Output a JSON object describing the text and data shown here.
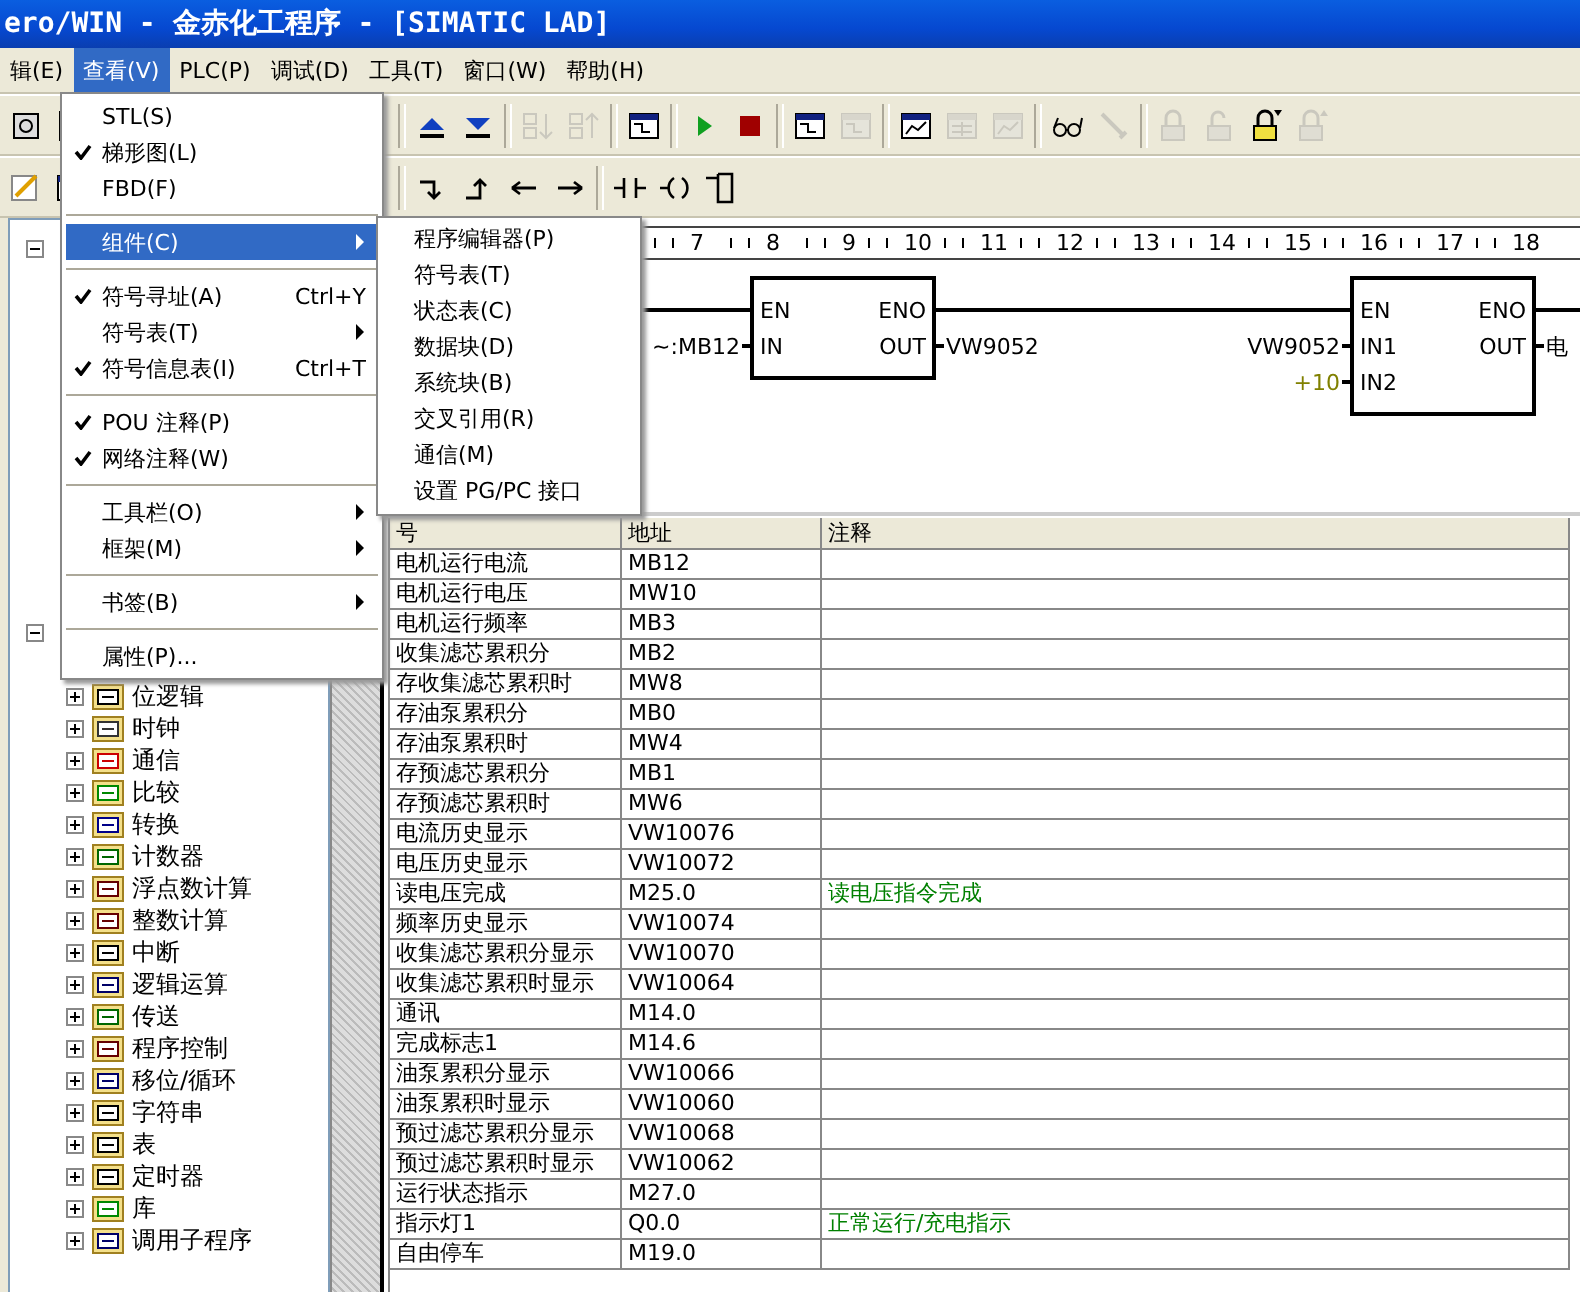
{
  "window": {
    "title": "ero/WIN - 金赤化工程序 - [SIMATIC LAD]"
  },
  "menu_bar": [
    {
      "label": "辑(E)",
      "selected": false
    },
    {
      "label": "查看(V)",
      "selected": true
    },
    {
      "label": "PLC(P)",
      "selected": false
    },
    {
      "label": "调试(D)",
      "selected": false
    },
    {
      "label": "工具(T)",
      "selected": false
    },
    {
      "label": "窗口(W)",
      "selected": false
    },
    {
      "label": "帮助(H)",
      "selected": false
    }
  ],
  "toolbars": [
    {
      "left": [
        {
          "kind": "print",
          "disabled": false
        },
        {
          "kind": "preview",
          "disabled": false
        }
      ],
      "right": [
        [
          {
            "kind": "up",
            "disabled": false
          },
          {
            "kind": "down",
            "disabled": false
          }
        ],
        [
          {
            "kind": "sort-asc",
            "disabled": true
          },
          {
            "kind": "sort-desc",
            "disabled": true
          }
        ],
        [
          {
            "kind": "window",
            "disabled": false
          }
        ],
        [
          {
            "kind": "play",
            "disabled": false
          },
          {
            "kind": "stop",
            "disabled": false
          }
        ],
        [
          {
            "kind": "network",
            "disabled": false
          },
          {
            "kind": "network",
            "disabled": true
          }
        ],
        [
          {
            "kind": "chart",
            "disabled": false
          },
          {
            "kind": "grid",
            "disabled": true
          },
          {
            "kind": "chart",
            "disabled": true
          }
        ],
        [
          {
            "kind": "glasses",
            "disabled": false
          },
          {
            "kind": "pen",
            "disabled": true
          }
        ],
        [
          {
            "kind": "lock",
            "disabled": true
          },
          {
            "kind": "unlock",
            "disabled": true
          },
          {
            "kind": "lock-t",
            "disabled": false
          },
          {
            "kind": "lock-up",
            "disabled": true
          }
        ]
      ]
    },
    {
      "left": [
        {
          "kind": "edit",
          "disabled": false
        },
        {
          "kind": "grid",
          "disabled": false
        }
      ],
      "right": [
        [
          {
            "kind": "branch-down",
            "disabled": false
          },
          {
            "kind": "branch-up",
            "disabled": false
          },
          {
            "kind": "left",
            "disabled": false
          },
          {
            "kind": "right",
            "disabled": false
          }
        ],
        [
          {
            "kind": "contact",
            "disabled": false
          },
          {
            "kind": "coil",
            "disabled": false
          },
          {
            "kind": "box",
            "disabled": false
          }
        ]
      ]
    }
  ],
  "view_menu": {
    "groups": [
      [
        {
          "label": "STL(S)",
          "checked": false
        },
        {
          "label": "梯形图(L)",
          "checked": true
        },
        {
          "label": "FBD(F)",
          "checked": false
        }
      ],
      [
        {
          "label": "组件(C)",
          "checked": false,
          "submenu": true,
          "selected": true
        }
      ],
      [
        {
          "label": "符号寻址(A)",
          "shortcut": "Ctrl+Y",
          "checked": true
        },
        {
          "label": "符号表(T)",
          "checked": false,
          "submenu": true
        },
        {
          "label": "符号信息表(I)",
          "shortcut": "Ctrl+T",
          "checked": true
        }
      ],
      [
        {
          "label": "POU 注释(P)",
          "checked": true
        },
        {
          "label": "网络注释(W)",
          "checked": true
        }
      ],
      [
        {
          "label": "工具栏(O)",
          "checked": false,
          "submenu": true
        },
        {
          "label": "框架(M)",
          "checked": false,
          "submenu": true
        }
      ],
      [
        {
          "label": "书签(B)",
          "checked": false,
          "submenu": true
        }
      ],
      [
        {
          "label": "属性(P)...",
          "checked": false
        }
      ]
    ]
  },
  "submenu": [
    "程序编辑器(P)",
    "符号表(T)",
    "状态表(C)",
    "数据块(D)",
    "系统块(B)",
    "交叉引用(R)",
    "通信(M)",
    "设置 PG/PC 接口"
  ],
  "tree": [
    {
      "expanded": true
    },
    {
      "expanded": true,
      "children": [
        {
          "label": "位逻辑",
          "kind": "contact"
        },
        {
          "label": "时钟",
          "kind": "clock"
        },
        {
          "label": "通信",
          "kind": "bolt"
        },
        {
          "label": "比较",
          "kind": "compare"
        },
        {
          "label": "转换",
          "kind": "convert"
        },
        {
          "label": "计数器",
          "kind": "counter"
        },
        {
          "label": "浮点数计算",
          "kind": "real"
        },
        {
          "label": "整数计算",
          "kind": "int"
        },
        {
          "label": "中断",
          "kind": "interrupt"
        },
        {
          "label": "逻辑运算",
          "kind": "logic"
        },
        {
          "label": "传送",
          "kind": "move"
        },
        {
          "label": "程序控制",
          "kind": "jump"
        },
        {
          "label": "移位/循环",
          "kind": "shift"
        },
        {
          "label": "字符串",
          "kind": "string"
        },
        {
          "label": "表",
          "kind": "table"
        },
        {
          "label": "定时器",
          "kind": "timer"
        },
        {
          "label": "库",
          "kind": "library"
        },
        {
          "label": "调用子程序",
          "kind": "call"
        }
      ]
    }
  ],
  "ruler": [
    "7",
    "8",
    "9",
    "10",
    "11",
    "12",
    "13",
    "14",
    "15",
    "16",
    "17",
    "18"
  ],
  "ladder": {
    "blocks": [
      {
        "inputs": [
          {
            "pin": "EN"
          },
          {
            "pin": "IN",
            "operand": "~:MB12"
          }
        ],
        "outputs": [
          {
            "pin": "ENO"
          },
          {
            "pin": "OUT",
            "operand": "VW9052"
          }
        ]
      },
      {
        "inputs": [
          {
            "pin": "EN"
          },
          {
            "pin": "IN1",
            "operand": "VW9052"
          },
          {
            "pin": "IN2",
            "operand": "+10",
            "constant": true
          }
        ],
        "outputs": [
          {
            "pin": "ENO"
          },
          {
            "pin": "OUT",
            "operand": "电"
          }
        ]
      }
    ]
  },
  "symbol_table": {
    "columns": [
      "号",
      "地址",
      "注释"
    ],
    "rows": [
      {
        "symbol": "电机运行电流",
        "address": "MB12"
      },
      {
        "symbol": "电机运行电压",
        "address": "MW10"
      },
      {
        "symbol": "电机运行频率",
        "address": "MB3"
      },
      {
        "symbol": "收集滤芯累积分",
        "address": "MB2"
      },
      {
        "symbol": "存收集滤芯累积时",
        "address": "MW8"
      },
      {
        "symbol": "存油泵累积分",
        "address": "MB0"
      },
      {
        "symbol": "存油泵累积时",
        "address": "MW4"
      },
      {
        "symbol": "存预滤芯累积分",
        "address": "MB1"
      },
      {
        "symbol": "存预滤芯累积时",
        "address": "MW6"
      },
      {
        "symbol": "电流历史显示",
        "address": "VW10076"
      },
      {
        "symbol": "电压历史显示",
        "address": "VW10072"
      },
      {
        "symbol": "读电压完成",
        "address": "M25.0",
        "comment": "读电压指令完成"
      },
      {
        "symbol": "频率历史显示",
        "address": "VW10074"
      },
      {
        "symbol": "收集滤芯累积分显示",
        "address": "VW10070"
      },
      {
        "symbol": "收集滤芯累积时显示",
        "address": "VW10064"
      },
      {
        "symbol": "通讯",
        "address": "M14.0"
      },
      {
        "symbol": "完成标志1",
        "address": "M14.6"
      },
      {
        "symbol": "油泵累积分显示",
        "address": "VW10066"
      },
      {
        "symbol": "油泵累积时显示",
        "address": "VW10060"
      },
      {
        "symbol": "预过滤芯累积分显示",
        "address": "VW10068"
      },
      {
        "symbol": "预过滤芯累积时显示",
        "address": "VW10062"
      },
      {
        "symbol": "运行状态指示",
        "address": "M27.0"
      },
      {
        "symbol": "指示灯1",
        "address": "Q0.0",
        "comment": "正常运行/充电指示"
      },
      {
        "symbol": "自由停车",
        "address": "M19.0"
      }
    ]
  }
}
